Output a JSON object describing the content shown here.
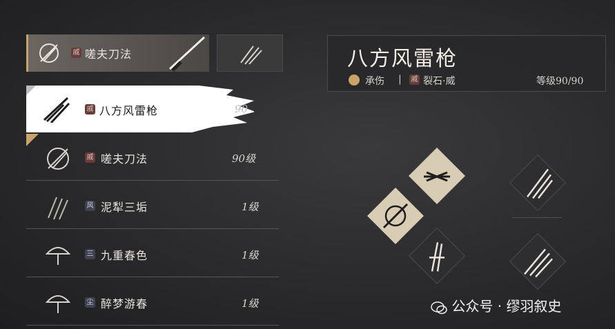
{
  "equipped": {
    "name": "嗟夫刀法",
    "seal": "戚"
  },
  "list": [
    {
      "name": "八方风雷枪",
      "seal": "戚",
      "level": "90",
      "selected": true
    },
    {
      "name": "嗟夫刀法",
      "seal": "戚",
      "level": "90级",
      "selected": false
    },
    {
      "name": "泥犁三垢",
      "seal": "风",
      "level": "1级",
      "selected": false
    },
    {
      "name": "九重春色",
      "seal": "三",
      "level": "1级",
      "selected": false
    },
    {
      "name": "醉梦游春",
      "seal": "尘",
      "level": "1级",
      "selected": false
    }
  ],
  "detail": {
    "title": "八方风雷枪",
    "tag1": "承伤",
    "divider": "|",
    "seal": "戚",
    "tag2": "裂石·威",
    "level": "等级90/90"
  },
  "watermark": {
    "dot": "·",
    "prefix": "公众号",
    "name": "缪羽叙史"
  },
  "colors": {
    "accent": "#c9a368",
    "selected_bg": "#ffffff",
    "diamond_light": "#d8cdb4"
  },
  "icons": [
    "spear-icon",
    "blade-icon",
    "claw-icon",
    "umbrella-icon",
    "wechat-icon",
    "checkmark-icon"
  ]
}
